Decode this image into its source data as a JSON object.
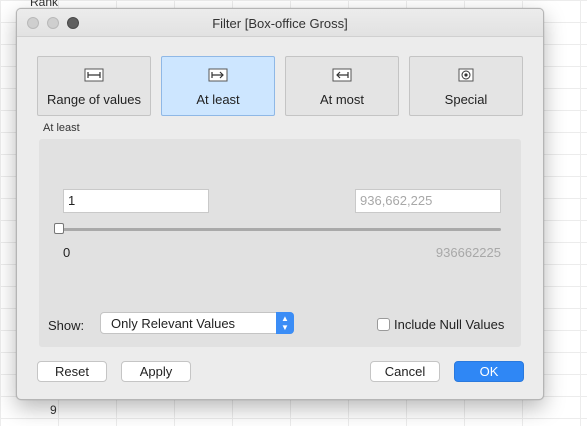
{
  "background": {
    "rank_header": "Rank",
    "row_number": "9"
  },
  "window": {
    "title": "Filter [Box-office Gross]"
  },
  "tabs": [
    {
      "label": "Range of values",
      "icon": "range-icon",
      "active": false
    },
    {
      "label": "At least",
      "icon": "at-least-icon",
      "active": true
    },
    {
      "label": "At most",
      "icon": "at-most-icon",
      "active": false
    },
    {
      "label": "Special",
      "icon": "special-icon",
      "active": false
    }
  ],
  "section_label": "At least",
  "range": {
    "min_value": "1",
    "max_placeholder": "936,662,225",
    "axis_min": "0",
    "axis_max": "936662225"
  },
  "show": {
    "label": "Show:",
    "selected": "Only Relevant Values"
  },
  "include_null": {
    "label": "Include Null Values",
    "checked": false
  },
  "buttons": {
    "reset": "Reset",
    "apply": "Apply",
    "cancel": "Cancel",
    "ok": "OK"
  },
  "colors": {
    "accent": "#2f87f5",
    "active_tab": "#cde6ff"
  }
}
